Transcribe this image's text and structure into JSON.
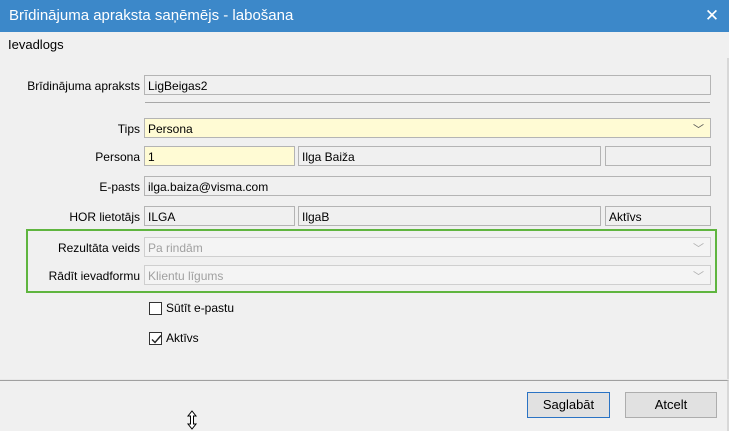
{
  "window": {
    "title": "Brīdinājuma apraksta saņēmējs - labošana",
    "close_glyph": "✕"
  },
  "toolbar": {
    "tab": "Ievadlogs"
  },
  "form": {
    "description_label": "Brīdinājuma apraksts",
    "description_value": "LigBeigas2",
    "type_label": "Tips",
    "type_value": "Persona",
    "person_label": "Persona",
    "person_code": "1",
    "person_name": "Ilga Baiža",
    "person_extra": "",
    "email_label": "E-pasts",
    "email_value": "ilga.baiza@visma.com",
    "hor_label": "HOR lietotājs",
    "hor_user": "ILGA",
    "hor_login": "IlgaB",
    "hor_status": "Aktīvs",
    "result_label": "Rezultāta veids",
    "result_value": "Pa rindām",
    "show_form_label": "Rādīt ievadformu",
    "show_form_value": "Klientu līgums",
    "send_email_label": "Sūtīt e-pastu",
    "send_email_checked": false,
    "active_label": "Aktīvs",
    "active_checked": true
  },
  "buttons": {
    "save": "Saglabāt",
    "cancel": "Atcelt"
  },
  "colors": {
    "titlebar": "#3c88c9",
    "highlight_box": "#5fb53f",
    "required_field": "#fffbd4"
  }
}
